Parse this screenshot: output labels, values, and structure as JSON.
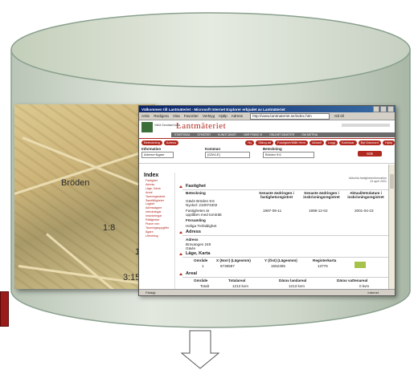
{
  "window": {
    "title": "Välkommen till Lantmäteriet - Microsoft Internet Explorer erbjudet av Lantmäteriet",
    "menu": [
      "Arkiv",
      "Redigera",
      "Visa",
      "Favoriter",
      "Verktyg",
      "Hjälp"
    ],
    "address_label": "Adress",
    "address_value": "http://www.lantmateriet.se/index.htm",
    "go_label": "Gå till",
    "status_text": "Färdigt",
    "status_zone": "Internet"
  },
  "site": {
    "brand": "Lantmäteriet",
    "logo_text": "Värld Geodata Karta",
    "nav": [
      "STARTSIDA",
      "SYNSTER",
      "KUNDTJÄNST",
      "HÄR FINNS VI",
      "ONLINETJÄNSTER",
      "OM METRIA"
    ],
    "buttons_left": [
      "Beteckning",
      "Adress"
    ],
    "buttons_right": [
      "Ny",
      "Stäng alt",
      "Fastighet/Mått Hem",
      "Aktuell",
      "Logg",
      "Kartvisar",
      "Byt lösenord",
      "Hjälp"
    ]
  },
  "form": {
    "info_label": "Information",
    "info_value": "Adress+Ägare",
    "kommun_label": "Kommun",
    "kommun_value": "[GÄVLE]",
    "beteckning_label": "Beteckning",
    "beteckning_value": "Bröden 9:6",
    "submit_label": "Sök"
  },
  "sidebar": {
    "title": "Index",
    "items": [
      "Fastighet",
      "Adress",
      "Läge, Karta",
      "Areal",
      "Taxeringsvärde",
      "Samfälligheter",
      "Lagfart",
      "Adressägare",
      "Inteckningar",
      "Inskrivningar",
      "Rättigheter",
      "Planer mm",
      "Taxeringsuppgifter",
      "Ägare",
      "Utredning"
    ]
  },
  "note": {
    "line1": "Aktuella fastighetsinformation",
    "line2": "24 april 2001"
  },
  "fastighet": {
    "heading": "Fastighet",
    "col_beteckning": "Beteckning",
    "col_senaste_fast": "Senaste ändringen i fastighetsregistret",
    "col_senaste_inskr": "Senaste ändringen i inskrivningsregistret",
    "col_aktualitet": "Aktualitetsdatum i inskrivningsregistret",
    "name": "Gävle Bröden 9:6",
    "nyckel": "Nyckel: 210074302",
    "row_text": "Fastigheten är upplåten med tomträtt",
    "date1": "1997-09-11",
    "date2": "1998-12-02",
    "date3": "2001-04-23",
    "forsamling_label": "Församling",
    "forsamling_value": "Heliga Trefaldighet"
  },
  "adress": {
    "heading": "Adress",
    "label": "Adress",
    "line1": "Brovangen 249",
    "line2": "Gävle"
  },
  "lage": {
    "heading": "Läge, Karta",
    "col_omrade": "Område",
    "col_x": "X (Norr) (Lägesmm)",
    "col_y": "Y (Öst) (Lägesmm)",
    "col_reg": "Registerkarta",
    "omrade": "1",
    "x": "6736597",
    "y": "1552305",
    "reg": "13776"
  },
  "areal": {
    "heading": "Areal",
    "col_omrade": "Område",
    "col_total": "Totalareal",
    "col_land": "Därav landareal",
    "col_vatten": "Därav vattenareal",
    "row_label": "Totalt",
    "total": "1213 kvm",
    "land": "1213 kvm",
    "vatten": "0 kvm"
  },
  "map_labels": [
    "Bröden",
    "1:8",
    "1:2",
    "3:15"
  ],
  "colors": {
    "brand_red": "#b0281f",
    "cylinder": "#d6ddd3",
    "cylinder_edge": "#8aa08e"
  }
}
